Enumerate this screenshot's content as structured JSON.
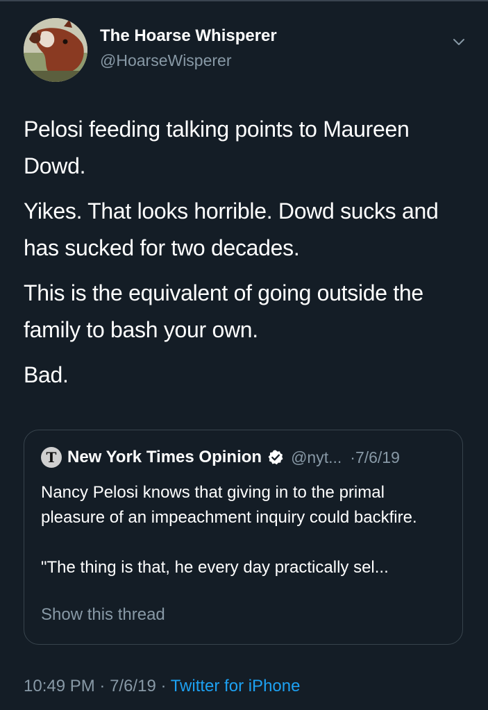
{
  "tweet": {
    "author": {
      "display_name": "The Hoarse Whisperer",
      "handle": "@HoarseWisperer",
      "avatar": "horse-avatar"
    },
    "menu_icon": "chevron-down-icon",
    "paragraphs": [
      "Pelosi feeding talking points to Maureen Dowd.",
      "Yikes. That looks horrible. Dowd sucks and has sucked for two decades.",
      "This is the equivalent of going outside the family to bash your own.",
      "Bad."
    ],
    "quoted": {
      "logo_glyph": "T",
      "name": "New York Times Opinion",
      "verified_icon": "verified-badge-icon",
      "handle": "@nyt...",
      "date": "·7/6/19",
      "text_1": "Nancy Pelosi knows that giving in to the primal pleasure of an impeachment inquiry could backfire.",
      "text_2": "\"The thing is that, he every day practically sel...",
      "show_thread": "Show this thread"
    },
    "footer": {
      "time": "10:49 PM",
      "sep_1": " · ",
      "date": "7/6/19",
      "sep_2": " · ",
      "source": "Twitter for iPhone"
    }
  },
  "colors": {
    "background": "#141d26",
    "secondary_text": "#8899a6",
    "link": "#1da1f2",
    "border": "#38444d"
  }
}
